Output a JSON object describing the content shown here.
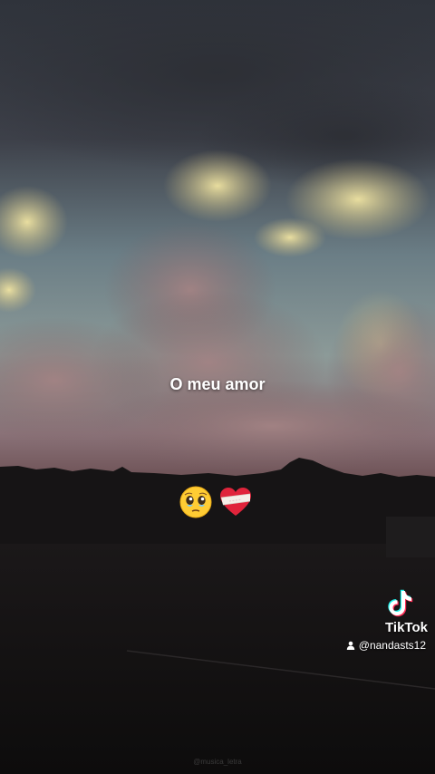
{
  "caption": "O meu amor",
  "emojis": {
    "first": "pleading-face-with-tears-icon",
    "second": "mending-heart-icon"
  },
  "tiktok": {
    "brand": "TikTok",
    "username": "@nandasts12",
    "user_icon": "person-icon"
  },
  "watermark": "@musica_letra",
  "colors": {
    "sky_top": "#3a3e48",
    "cloud_glow": "#e8dc9a",
    "cloud_pink": "#a07f7f",
    "horizon": "#8a6d6d",
    "ground": "#151313",
    "tiktok_cyan": "#25F4EE",
    "tiktok_red": "#FE2C55"
  }
}
